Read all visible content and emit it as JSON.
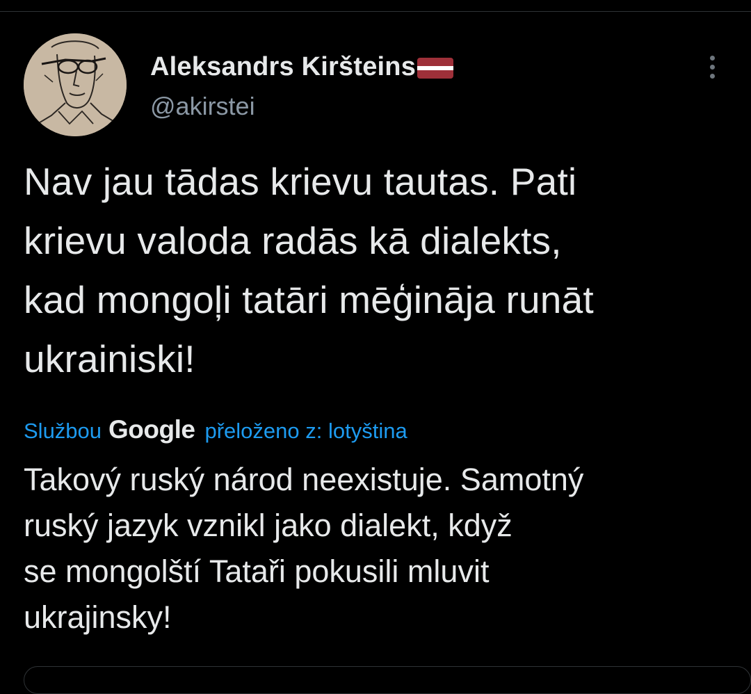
{
  "tweet": {
    "author": {
      "display_name": "Aleksandrs Kiršteins",
      "handle": "@akirstei",
      "flag_colors": {
        "red": "#9e3039",
        "white": "#ffffff"
      }
    },
    "text_lines": [
      "Nav jau tādas krievu tautas. Pati",
      "krievu valoda radās kā dialekts,",
      "kad mongoļi tatāri mēģināja runāt",
      "ukrainiski!"
    ],
    "translation": {
      "prefix": "Službou",
      "provider": "Google",
      "suffix": "přeloženo z: lotyština",
      "lines": [
        "Takový ruský národ neexistuje. Samotný",
        "ruský jazyk vznikl jako dialekt, když",
        "se mongolští Tataři pokusili mluvit",
        "ukrajinsky!"
      ]
    }
  },
  "colors": {
    "background": "#000000",
    "text": "#e7e9ea",
    "secondary_text": "#8b98a5",
    "accent": "#1d9bf0",
    "border": "#2f3336"
  },
  "icons": {
    "more": "more-dots-vertical-icon",
    "flag": "latvia-flag-icon"
  }
}
